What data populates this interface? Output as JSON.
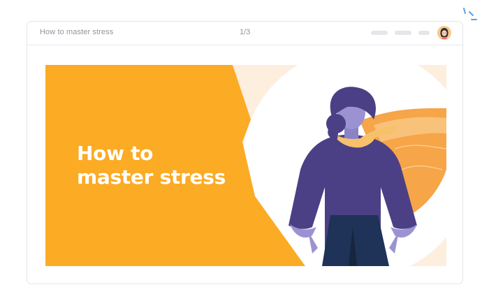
{
  "window": {
    "doc_title": "How to master stress",
    "page_counter": "1/3"
  },
  "slide": {
    "title_line1": "How to",
    "title_line2": "master stress"
  },
  "icons": {
    "sparkle": "sparkle-icon",
    "avatar": "user-avatar"
  },
  "colors": {
    "accent_orange": "#fbab24",
    "figure_purple": "#4b3f86",
    "figure_navy": "#1f3257",
    "skin": "#9b93d1",
    "scarf": "#f7c16b",
    "background_peach": "#fdeede",
    "sparkle_blue": "#5aa0e8"
  }
}
